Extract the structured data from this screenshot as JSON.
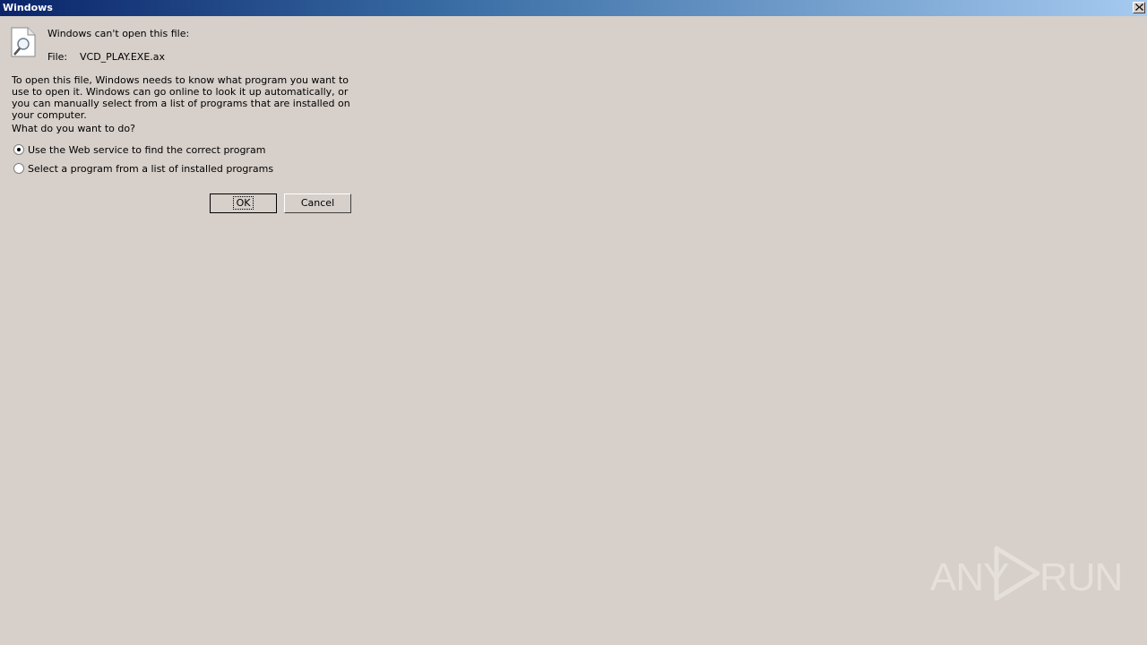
{
  "window": {
    "title": "Windows"
  },
  "dialog": {
    "heading": "Windows can't open this file:",
    "file_label": "File:",
    "file_name": "VCD_PLAY.EXE.ax",
    "description": "To open this file, Windows needs to know what program you want to use to open it. Windows can go online to look it up automatically, or you can manually select from a list of programs that are installed on your computer.",
    "question": "What do you want to do?",
    "options": [
      {
        "label": "Use the Web service to find the correct program",
        "selected": true
      },
      {
        "label": "Select a program from a list of installed programs",
        "selected": false
      }
    ],
    "ok_label": "OK",
    "cancel_label": "Cancel"
  },
  "watermark": {
    "left_text": "ANY",
    "right_text": "RUN"
  }
}
